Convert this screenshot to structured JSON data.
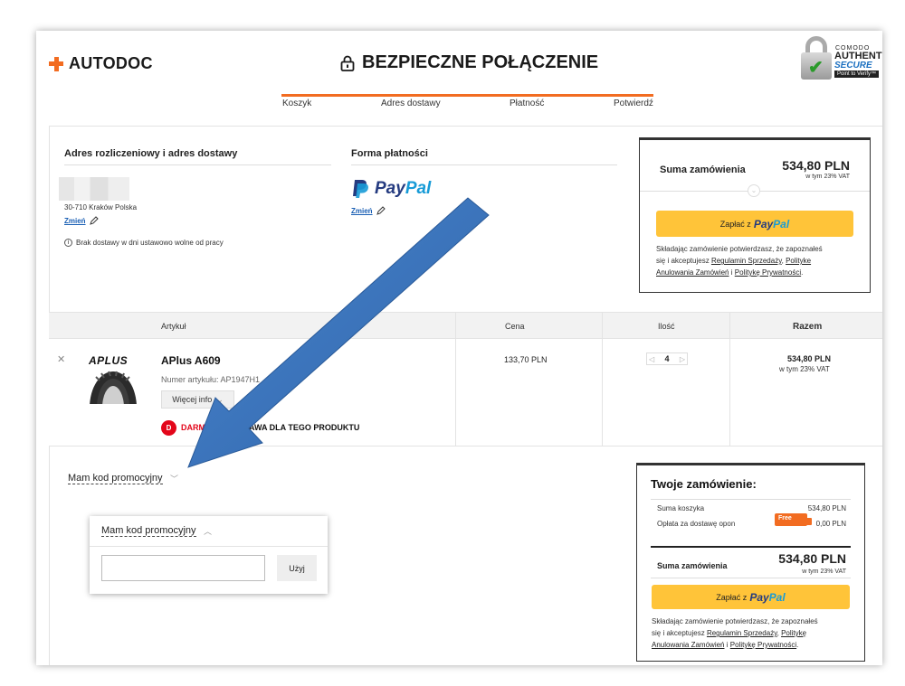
{
  "header": {
    "logo_text": "AUTODOC",
    "secure_title": "BEZPIECZNE POŁĄCZENIE",
    "comodo": {
      "line1": "COMODO",
      "line2": "AUTHENTIC",
      "line3": "SECURE",
      "line4": "Point to Verify™"
    }
  },
  "steps": [
    "Koszyk",
    "Adres dostawy",
    "Płatność",
    "Potwierdź"
  ],
  "address": {
    "heading": "Adres rozliczeniowy i adres dostawy",
    "city": "30-710 Kraków Polska",
    "change_label": "Zmień",
    "info": "Brak dostawy w dni ustawowo wolne od pracy"
  },
  "payment": {
    "heading": "Forma płatności",
    "brand_a": "Pay",
    "brand_b": "Pal",
    "change_label": "Zmień"
  },
  "summary_top": {
    "label": "Suma zamówienia",
    "amount": "534,80 PLN",
    "vat": "w tym 23% VAT",
    "pay_prefix": "Zapłać z",
    "pay_brand_a": "Pay",
    "pay_brand_b": "Pal",
    "terms_1": "Składając zamówienie potwierdzasz, że zapoznałeś",
    "terms_2": "się i akceptujesz",
    "terms_link1": "Regulamin Sprzedaży",
    "terms_link2": "Polityke",
    "terms_link3": "Anulowania Zamówień",
    "terms_and": "i",
    "terms_link4": "Politykę Prywatności"
  },
  "table": {
    "columns": [
      "Artykuł",
      "Cena",
      "Ilość",
      "Razem"
    ],
    "row": {
      "brand_logo": "APLUS",
      "title": "APlus A609",
      "sku": "Numer artykułu: AP1947H1",
      "more_label": "Więcej info",
      "free_icon": "D",
      "free_text_red": "DARMOWA DO",
      "free_text_dark": "STAWA DLA TEGO PRODUKTU",
      "price": "133,70 PLN",
      "quantity": "4",
      "total": "534,80 PLN",
      "total_vat": "w tym 23% VAT"
    }
  },
  "promo": {
    "link_label": "Mam kod promocyjny",
    "popup_title": "Mam kod promocyjny",
    "input_value": "",
    "apply_label": "Użyj"
  },
  "order_box": {
    "heading": "Twoje zamówienie:",
    "cart_label": "Suma koszyka",
    "cart_value": "534,80 PLN",
    "shipping_label": "Opłata za dostawę opon",
    "free_badge": "Free",
    "shipping_value": "0,00 PLN",
    "total_label": "Suma zamówienia",
    "total_value": "534,80 PLN",
    "total_vat": "w tym 23% VAT",
    "pay_prefix": "Zapłać z",
    "pay_brand_a": "Pay",
    "pay_brand_b": "Pal",
    "terms_1": "Składając zamówienie potwierdzasz, że zapoznałeś",
    "terms_2": "się i akceptujesz",
    "terms_link1": "Regulamin Sprzedaży",
    "terms_link2": "Politykę",
    "terms_link3": "Anulowania Zamówień",
    "terms_and": "i",
    "terms_link4": "Politykę Prywatności"
  },
  "colors": {
    "accent": "#f26c21",
    "paypal_yellow": "#ffc439",
    "link_blue": "#1a5fb4",
    "annotation_arrow": "#3a72b8"
  }
}
